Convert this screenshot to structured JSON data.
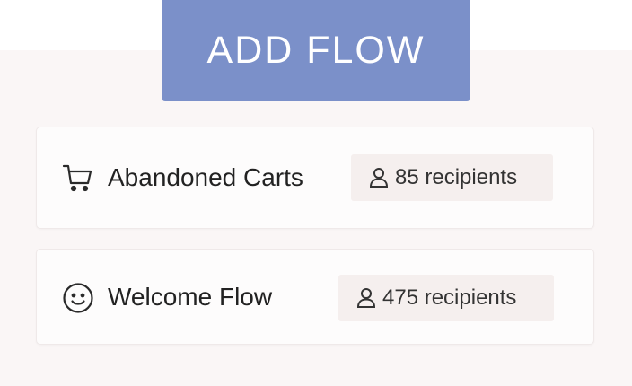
{
  "header": {
    "add_flow_label": "ADD FLOW"
  },
  "flows": [
    {
      "icon": "shopping-cart-icon",
      "name": "Abandoned Carts",
      "recipients": "85 recipients"
    },
    {
      "icon": "smiley-face-icon",
      "name": "Welcome Flow",
      "recipients": "475 recipients"
    }
  ],
  "colors": {
    "button_bg": "#7b90c9",
    "page_bg": "#faf6f6",
    "badge_bg": "#f5efee",
    "text": "#222222"
  }
}
